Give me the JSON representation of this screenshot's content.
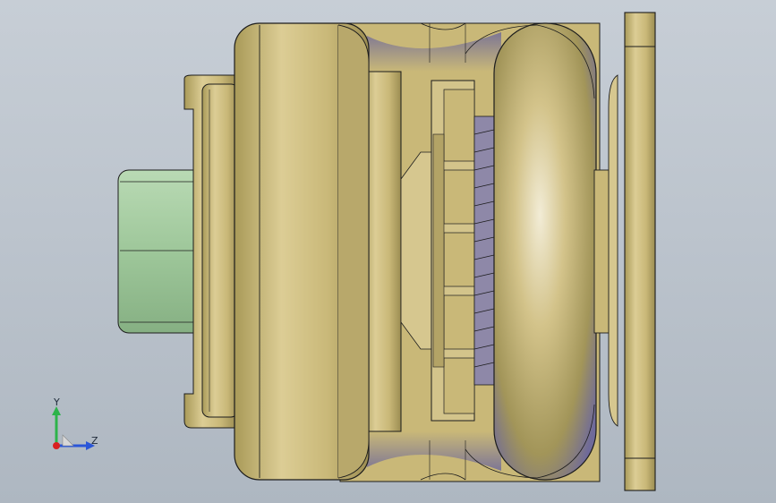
{
  "viewport": {
    "background_top": "#c7ced6",
    "background_bottom": "#aeb7c1"
  },
  "model": {
    "view": "side",
    "body_color": "#c9b878",
    "highlight_color": "#f2ecd6",
    "shadow_color": "#6f6a9a",
    "shaft_color": "#9ec79a",
    "edge_color": "#1c1c1c",
    "parts": [
      "left-shaft",
      "left-boss",
      "main-wheel",
      "hub-disc",
      "toothed-ring",
      "right-wheel",
      "mounting-flange"
    ]
  },
  "triad": {
    "y_label": "Y",
    "z_label": "Z",
    "y_color": "#2db34a",
    "z_color": "#2a56d8",
    "x_color": "#d92020"
  }
}
